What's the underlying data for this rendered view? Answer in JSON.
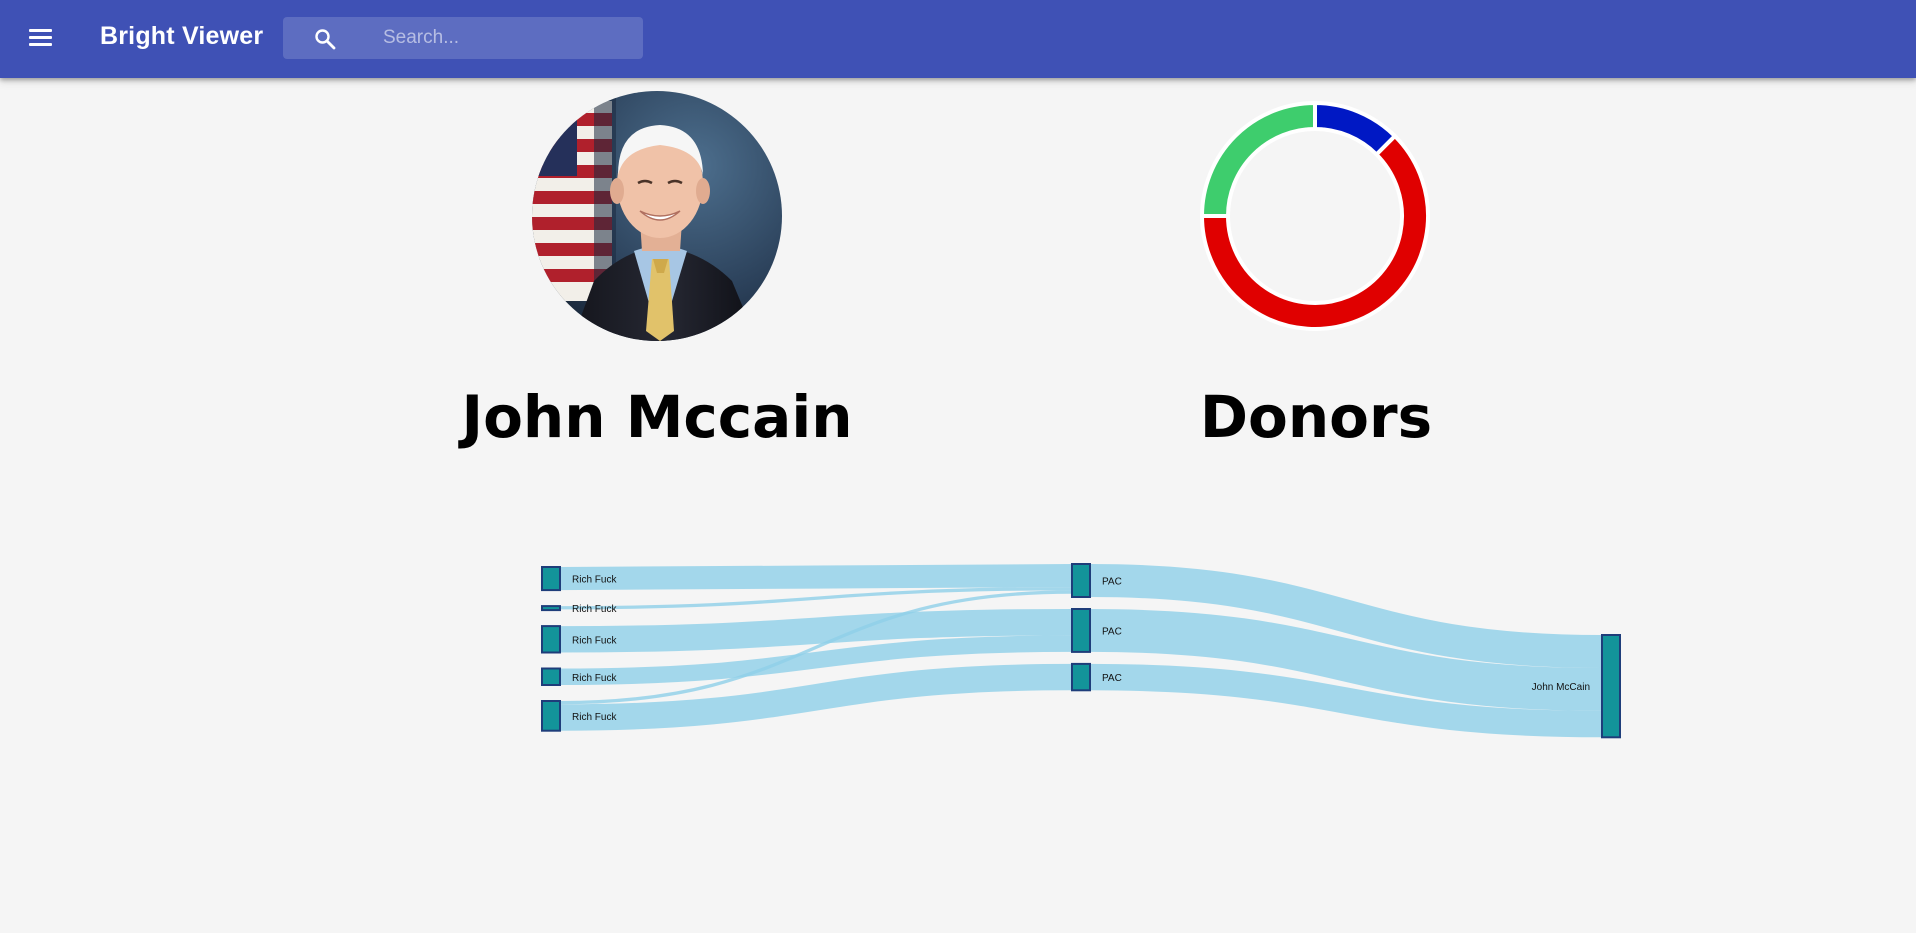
{
  "appbar": {
    "title": "Bright Viewer",
    "menu_icon": "menu-icon",
    "search": {
      "placeholder": "Search...",
      "value": "",
      "icon": "search-icon"
    }
  },
  "profile": {
    "name": "John Mccain",
    "photo": "portrait-photo"
  },
  "donors": {
    "heading": "Donors",
    "chart": {
      "type": "donut",
      "segments": [
        {
          "color": "#0018c4",
          "value": 12.5
        },
        {
          "color": "#e00000",
          "value": 62.5
        },
        {
          "color": "#3ecd6d",
          "value": 25
        }
      ]
    }
  },
  "sankey": {
    "colors": {
      "node_fill": "#13949a",
      "node_stroke": "#1e3d7a",
      "link": "#8fd0e8"
    },
    "nodes": [
      {
        "label": "Rich Fuck"
      },
      {
        "label": "Rich Fuck"
      },
      {
        "label": "Rich Fuck"
      },
      {
        "label": "Rich Fuck"
      },
      {
        "label": "Rich Fuck"
      },
      {
        "label": "PAC"
      },
      {
        "label": "PAC"
      },
      {
        "label": "PAC"
      },
      {
        "label": "John McCain"
      }
    ],
    "links": [
      {
        "source": 0,
        "target": 5,
        "value": 35
      },
      {
        "source": 1,
        "target": 5,
        "value": 5
      },
      {
        "source": 4,
        "target": 5,
        "value": 5
      },
      {
        "source": 2,
        "target": 6,
        "value": 40
      },
      {
        "source": 3,
        "target": 6,
        "value": 25
      },
      {
        "source": 4,
        "target": 7,
        "value": 40
      },
      {
        "source": 5,
        "target": 8,
        "value": 50
      },
      {
        "source": 6,
        "target": 8,
        "value": 65
      },
      {
        "source": 7,
        "target": 8,
        "value": 40
      }
    ]
  }
}
